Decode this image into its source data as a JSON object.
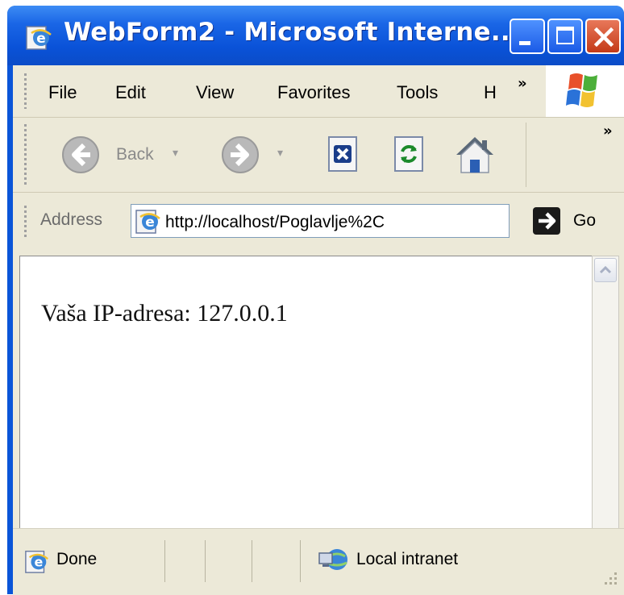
{
  "window": {
    "title": "WebForm2 - Microsoft Interne...",
    "colors": {
      "titlebar": "#0a55d8",
      "chrome": "#ece9d8",
      "close": "#c43a18"
    }
  },
  "menu": {
    "items": [
      "File",
      "Edit",
      "View",
      "Favorites",
      "Tools",
      "H"
    ],
    "overflow": "»"
  },
  "toolbar": {
    "back_label": "Back",
    "overflow": "»",
    "icons": [
      "back-icon",
      "forward-icon",
      "stop-icon",
      "refresh-icon",
      "home-icon"
    ]
  },
  "address": {
    "label": "Address",
    "url": "http://localhost/Poglavlje%2C",
    "go_label": "Go"
  },
  "page": {
    "text": "Vaša IP-adresa: 127.0.0.1"
  },
  "status": {
    "done_label": "Done",
    "zone_label": "Local intranet"
  }
}
